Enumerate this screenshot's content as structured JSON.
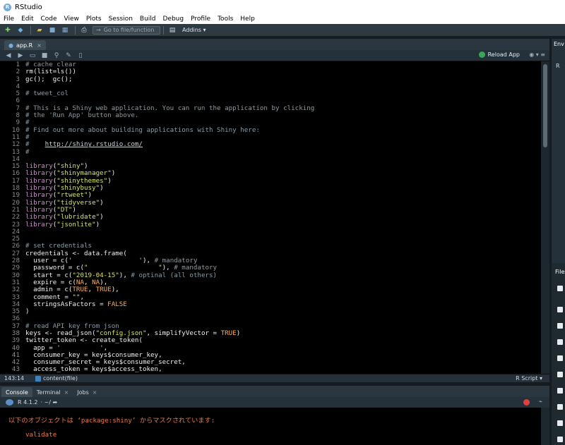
{
  "window": {
    "title": "RStudio"
  },
  "menu": [
    "File",
    "Edit",
    "Code",
    "View",
    "Plots",
    "Session",
    "Build",
    "Debug",
    "Profile",
    "Tools",
    "Help"
  ],
  "toolbar": {
    "goto_placeholder": "Go to file/function",
    "addins_label": "Addins"
  },
  "editor": {
    "tab_label": "app.R",
    "reload_label": "Reload App",
    "status": {
      "position": "143:14",
      "scope": "content(file)",
      "language": "R Script"
    },
    "lines": [
      {
        "n": "1",
        "t": [
          [
            "c-com",
            "# cache clear"
          ]
        ]
      },
      {
        "n": "2",
        "t": [
          [
            "src",
            "rm(list=ls())"
          ]
        ]
      },
      {
        "n": "3",
        "t": [
          [
            "src",
            "gc();  gc();"
          ]
        ]
      },
      {
        "n": "4",
        "t": []
      },
      {
        "n": "5",
        "t": [
          [
            "c-com",
            "# tweet_col"
          ]
        ]
      },
      {
        "n": "6",
        "t": []
      },
      {
        "n": "7",
        "t": [
          [
            "c-com",
            "# This is a Shiny web application. You can run the application by clicking"
          ]
        ]
      },
      {
        "n": "8",
        "t": [
          [
            "c-com",
            "# the 'Run App' button above."
          ]
        ]
      },
      {
        "n": "9",
        "t": [
          [
            "c-com",
            "#"
          ]
        ]
      },
      {
        "n": "10",
        "t": [
          [
            "c-com",
            "# Find out more about building applications with Shiny here:"
          ]
        ]
      },
      {
        "n": "11",
        "t": [
          [
            "c-com",
            "#"
          ]
        ]
      },
      {
        "n": "12",
        "t": [
          [
            "c-com",
            "#    "
          ],
          [
            "c-url",
            "http://shiny.rstudio.com/"
          ]
        ]
      },
      {
        "n": "13",
        "t": [
          [
            "c-com",
            "#"
          ]
        ]
      },
      {
        "n": "14",
        "t": []
      },
      {
        "n": "15",
        "t": [
          [
            "c-fn",
            "library"
          ],
          [
            "src",
            "("
          ],
          [
            "c-str",
            "\"shiny\""
          ],
          [
            "src",
            ")"
          ]
        ]
      },
      {
        "n": "16",
        "t": [
          [
            "c-fn",
            "library"
          ],
          [
            "src",
            "("
          ],
          [
            "c-str",
            "\"shinymanager\""
          ],
          [
            "src",
            ")"
          ]
        ]
      },
      {
        "n": "17",
        "t": [
          [
            "c-fn",
            "library"
          ],
          [
            "src",
            "("
          ],
          [
            "c-str",
            "\"shinythemes\""
          ],
          [
            "src",
            ")"
          ]
        ]
      },
      {
        "n": "18",
        "t": [
          [
            "c-fn",
            "library"
          ],
          [
            "src",
            "("
          ],
          [
            "c-str",
            "\"shinybusy\""
          ],
          [
            "src",
            ")"
          ]
        ]
      },
      {
        "n": "19",
        "t": [
          [
            "c-fn",
            "library"
          ],
          [
            "src",
            "("
          ],
          [
            "c-str",
            "\"rtweet\""
          ],
          [
            "src",
            ")"
          ]
        ]
      },
      {
        "n": "20",
        "t": [
          [
            "c-fn",
            "library"
          ],
          [
            "src",
            "("
          ],
          [
            "c-str",
            "\"tidyverse\""
          ],
          [
            "src",
            ")"
          ]
        ]
      },
      {
        "n": "21",
        "t": [
          [
            "c-fn",
            "library"
          ],
          [
            "src",
            "("
          ],
          [
            "c-str",
            "\"DT\""
          ],
          [
            "src",
            ")"
          ]
        ]
      },
      {
        "n": "22",
        "t": [
          [
            "c-fn",
            "library"
          ],
          [
            "src",
            "("
          ],
          [
            "c-str",
            "\"lubridate\""
          ],
          [
            "src",
            ")"
          ]
        ]
      },
      {
        "n": "23",
        "t": [
          [
            "c-fn",
            "library"
          ],
          [
            "src",
            "("
          ],
          [
            "c-str",
            "\"jsonlite\""
          ],
          [
            "src",
            ")"
          ]
        ]
      },
      {
        "n": "24",
        "t": []
      },
      {
        "n": "25",
        "t": []
      },
      {
        "n": "26",
        "t": [
          [
            "c-com",
            "# set credentials"
          ]
        ]
      },
      {
        "n": "27",
        "t": [
          [
            "src",
            "credentials <- data.frame("
          ]
        ]
      },
      {
        "n": "28",
        "t": [
          [
            "src",
            "  user = c("
          ],
          [
            "c-str",
            "'                 '"
          ],
          [
            "src",
            "), "
          ],
          [
            "c-com",
            "# mandatory"
          ]
        ]
      },
      {
        "n": "29",
        "t": [
          [
            "src",
            "  password = c("
          ],
          [
            "c-str",
            "\"                  \""
          ],
          [
            "src",
            "), "
          ],
          [
            "c-com",
            "# mandatory"
          ]
        ]
      },
      {
        "n": "30",
        "t": [
          [
            "src",
            "  start = c("
          ],
          [
            "c-str",
            "\"2019-04-15\""
          ],
          [
            "src",
            "), "
          ],
          [
            "c-com",
            "# optinal (all others)"
          ]
        ]
      },
      {
        "n": "31",
        "t": [
          [
            "src",
            "  expire = c("
          ],
          [
            "c-kw",
            "NA"
          ],
          [
            "src",
            ", "
          ],
          [
            "c-kw",
            "NA"
          ],
          [
            "src",
            "),"
          ]
        ]
      },
      {
        "n": "32",
        "t": [
          [
            "src",
            "  admin = c("
          ],
          [
            "c-kw",
            "TRUE"
          ],
          [
            "src",
            ", "
          ],
          [
            "c-kw",
            "TRUE"
          ],
          [
            "src",
            "),"
          ]
        ]
      },
      {
        "n": "33",
        "t": [
          [
            "src",
            "  comment = "
          ],
          [
            "c-str",
            "\"\""
          ],
          [
            "src",
            ","
          ]
        ]
      },
      {
        "n": "34",
        "t": [
          [
            "src",
            "  stringsAsFactors = "
          ],
          [
            "c-kw",
            "FALSE"
          ]
        ]
      },
      {
        "n": "35",
        "t": [
          [
            "src",
            ")"
          ]
        ]
      },
      {
        "n": "36",
        "t": []
      },
      {
        "n": "37",
        "t": [
          [
            "c-com",
            "# read API key from json"
          ]
        ]
      },
      {
        "n": "38",
        "t": [
          [
            "src",
            "keys <- read_json("
          ],
          [
            "c-str",
            "\"config.json\""
          ],
          [
            "src",
            ", simplifyVector = "
          ],
          [
            "c-kw",
            "TRUE"
          ],
          [
            "src",
            ")"
          ]
        ]
      },
      {
        "n": "39",
        "t": [
          [
            "src",
            "twitter_token <- create_token("
          ]
        ]
      },
      {
        "n": "40",
        "t": [
          [
            "src",
            "  app = "
          ],
          [
            "c-str",
            "'          '"
          ],
          [
            "src",
            ","
          ]
        ]
      },
      {
        "n": "41",
        "t": [
          [
            "src",
            "  consumer_key = keys$consumer_key,"
          ]
        ]
      },
      {
        "n": "42",
        "t": [
          [
            "src",
            "  consumer_secret = keys$consumer_secret,"
          ]
        ]
      },
      {
        "n": "43",
        "t": [
          [
            "src",
            "  access_token = keys$access_token,"
          ]
        ]
      },
      {
        "n": "44",
        "t": [
          [
            "src",
            "  access_secret = keys$access_secret,"
          ]
        ]
      }
    ]
  },
  "console": {
    "tabs": [
      "Console",
      "Terminal",
      "Jobs"
    ],
    "r_version": "R 4.1.2",
    "path": "~/",
    "message": "以下のオブジェクトは ‘package:shiny’ からマスクされています:",
    "value": "validate"
  },
  "right": {
    "env_tab": "Env",
    "files_tab": "Files",
    "r_label": "R"
  }
}
